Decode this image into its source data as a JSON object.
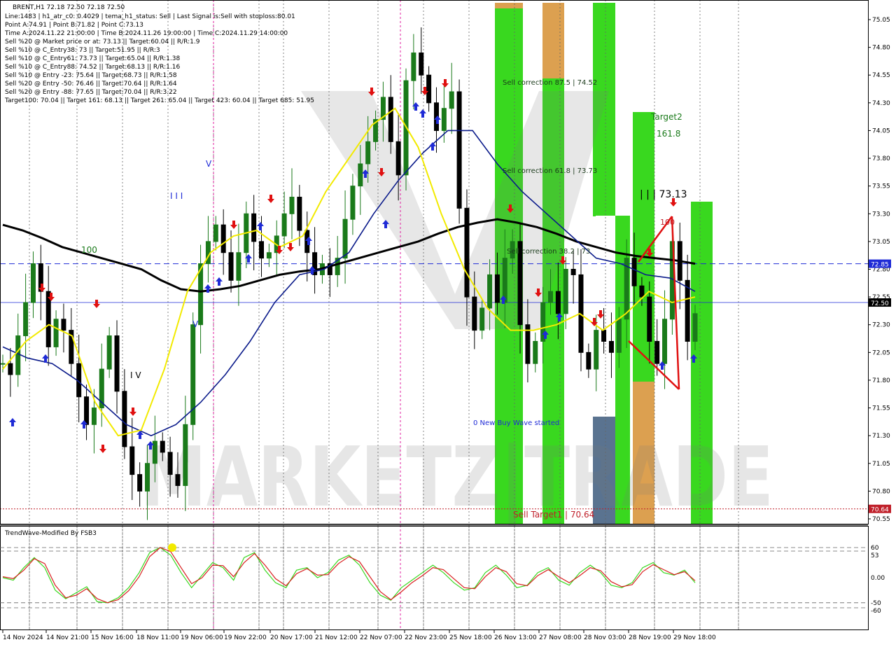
{
  "chart_data": [
    {
      "type": "candlestick",
      "symbol_line": "BRENT,H1  72.18 72.50 72.18 72.50",
      "info_lines": [
        "Line:1483 | h1_atr_c0: 0.4029 | tema_h1_status: Sell | Last Signal is:Sell with stoploss:80.01",
        "Point A:74.91 | Point B:71.82 | Point C:73.13",
        "Time A:2024.11.22 21:00:00 | Time B:2024.11.26 19:00:00 | Time C:2024.11.29 14:00:00",
        "Sell %20 @ Market price or at: 73.13 || Target:60.04 || R/R:1.9",
        "Sell %10 @ C_Entry38: 73 || Target:51.95 || R/R:3",
        "Sell %10 @ C_Entry61: 73.73 || Target:65.04 || R/R:1.38",
        "Sell %10 @ C_Entry88: 74.52 || Target:68.13 || R/R:1.16",
        "Sell %10 @ Entry -23: 75.64 || Target:68.73 || R/R:1.58",
        "Sell %20 @ Entry -50: 76.46 || Target:70.64 || R/R:1.64",
        "Sell %20 @ Entry -88: 77.65 || Target:70.04 || R/R:3.22",
        "Target100: 70.04 || Target 161: 68.13 || Target 261: 65.04 || Target 423: 60.04 || Target 685: 51.95"
      ],
      "y_ticks": [
        "75.05",
        "74.80",
        "74.55",
        "74.30",
        "74.05",
        "73.80",
        "73.55",
        "73.30",
        "73.05",
        "72.80",
        "72.55",
        "72.30",
        "72.05",
        "71.80",
        "71.55",
        "71.30",
        "71.05",
        "70.80",
        "70.55"
      ],
      "ylim": [
        70.5,
        75.2
      ],
      "x_labels": [
        "14 Nov 2024",
        "14 Nov 21:00",
        "15 Nov 16:00",
        "18 Nov 11:00",
        "19 Nov 06:00",
        "19 Nov 22:00",
        "20 Nov 17:00",
        "21 Nov 12:00",
        "22 Nov 07:00",
        "22 Nov 23:00",
        "25 Nov 18:00",
        "26 Nov 13:00",
        "27 Nov 08:00",
        "28 Nov 03:00",
        "28 Nov 19:00",
        "29 Nov 18:00"
      ],
      "price_markers": [
        {
          "label": "72.85",
          "value": 72.85,
          "color": "#1f2bd6"
        },
        {
          "label": "72.50",
          "value": 72.5,
          "color": "#000000"
        },
        {
          "label": "70.64",
          "value": 70.64,
          "color": "#c0202a"
        }
      ],
      "annotations": {
        "sell_correction_875": "Sell correction 87.5 | 74.52",
        "sell_correction_618": "Sell correction 61.8 | 73.73",
        "sell_correction_382": "Sell correction 38.2 | 73",
        "target2": "Target2",
        "fib_1618": "161.8",
        "point_c_label": "| | | 73.13",
        "new_buy_wave": "0 New Buy Wave started",
        "sell_target1": "Sell Target1 | 70.64",
        "wave_100": "100",
        "wave_v": "V",
        "wave_iii": "I I I",
        "wave_iv": "I V",
        "wave_v2": "V",
        "point_label_100b": "100"
      },
      "watermark": "MARKETZ|TRADE",
      "colors": {
        "bull": "#1a7a1a",
        "bear": "#000000",
        "sma": "#000000",
        "ema_blue": "#0a1a8a",
        "ema_yellow": "#f2ea00",
        "zone_green": "#39d81f",
        "zone_orange": "#dca050"
      },
      "candles_close": [
        71.95,
        71.85,
        72.2,
        72.5,
        72.85,
        72.6,
        72.1,
        72.35,
        72.25,
        71.95,
        71.65,
        71.4,
        71.55,
        71.9,
        72.2,
        71.7,
        71.2,
        70.95,
        70.8,
        71.05,
        71.25,
        71.15,
        70.95,
        70.85,
        71.4,
        72.3,
        72.85,
        73.05,
        73.2,
        72.95,
        72.7,
        72.95,
        73.3,
        73.05,
        72.9,
        72.95,
        73.1,
        73.3,
        73.45,
        73.15,
        72.95,
        72.75,
        72.85,
        72.75,
        72.9,
        73.25,
        73.55,
        73.75,
        73.95,
        74.15,
        74.35,
        73.95,
        73.65,
        74.5,
        74.75,
        74.55,
        74.3,
        74.05,
        74.25,
        74.4,
        73.35,
        72.55,
        72.25,
        72.45,
        72.75,
        72.5,
        72.9,
        73.05,
        72.3,
        71.95,
        72.15,
        72.5,
        72.6,
        72.4,
        72.8,
        72.75,
        72.05,
        71.9,
        72.25,
        72.15,
        72.05,
        72.35,
        72.9,
        72.65,
        72.55,
        72.15,
        71.95,
        72.35,
        73.05,
        72.7,
        72.15,
        72.4
      ],
      "sma_values": [
        73.2,
        73.15,
        73.08,
        73.0,
        72.95,
        72.9,
        72.85,
        72.8,
        72.7,
        72.62,
        72.6,
        72.62,
        72.65,
        72.7,
        72.75,
        72.78,
        72.8,
        72.85,
        72.9,
        72.95,
        73.0,
        73.05,
        73.12,
        73.18,
        73.22,
        73.25,
        73.22,
        73.18,
        73.12,
        73.05,
        73.0,
        72.95,
        72.92,
        72.9,
        72.88,
        72.85
      ],
      "ema_blue_values": [
        72.1,
        72.0,
        71.95,
        71.8,
        71.6,
        71.4,
        71.3,
        71.4,
        71.6,
        71.85,
        72.15,
        72.5,
        72.75,
        72.8,
        72.95,
        73.3,
        73.6,
        73.85,
        74.05,
        74.05,
        73.75,
        73.5,
        73.3,
        73.1,
        72.9,
        72.85,
        72.75,
        72.72,
        72.6
      ],
      "ema_yellow_values": [
        71.9,
        72.15,
        72.3,
        72.2,
        71.6,
        71.3,
        71.35,
        71.9,
        72.6,
        72.95,
        73.1,
        73.15,
        73.0,
        73.1,
        73.5,
        73.8,
        74.1,
        74.25,
        73.9,
        73.3,
        72.8,
        72.45,
        72.25,
        72.25,
        72.3,
        72.4,
        72.25,
        72.4,
        72.6,
        72.5,
        72.55
      ]
    },
    {
      "type": "line",
      "title": "TrendWave-Modified By FSB3",
      "y_ticks": [
        "60",
        "53",
        "0.00",
        "-50",
        "-60"
      ],
      "ylim": [
        -75,
        75
      ],
      "colors": {
        "fast": "#39d81f",
        "slow": "#d81f1f"
      },
      "series": [
        {
          "values": [
            0,
            -5,
            20,
            40,
            20,
            -25,
            -42,
            -30,
            -18,
            -48,
            -50,
            -40,
            -20,
            10,
            50,
            60,
            45,
            10,
            -20,
            5,
            30,
            20,
            -5,
            40,
            50,
            15,
            -10,
            -20,
            15,
            20,
            0,
            10,
            35,
            45,
            25,
            -10,
            -35,
            -45,
            -20,
            -5,
            10,
            25,
            10,
            -10,
            -25,
            -20,
            10,
            25,
            5,
            -20,
            -15,
            10,
            20,
            -5,
            -15,
            10,
            25,
            10,
            -15,
            -20,
            -10,
            20,
            30,
            10,
            5,
            15,
            -10
          ]
        },
        {
          "values": [
            2,
            -2,
            15,
            38,
            28,
            -15,
            -40,
            -35,
            -22,
            -42,
            -50,
            -44,
            -26,
            2,
            42,
            60,
            52,
            20,
            -12,
            0,
            25,
            24,
            2,
            30,
            48,
            25,
            -2,
            -16,
            8,
            18,
            5,
            6,
            28,
            42,
            32,
            2,
            -28,
            -44,
            -28,
            -10,
            4,
            20,
            16,
            -2,
            -20,
            -22,
            2,
            20,
            12,
            -12,
            -16,
            4,
            16,
            2,
            -10,
            4,
            20,
            14,
            -8,
            -18,
            -14,
            12,
            26,
            16,
            6,
            12,
            -6
          ]
        }
      ]
    }
  ]
}
